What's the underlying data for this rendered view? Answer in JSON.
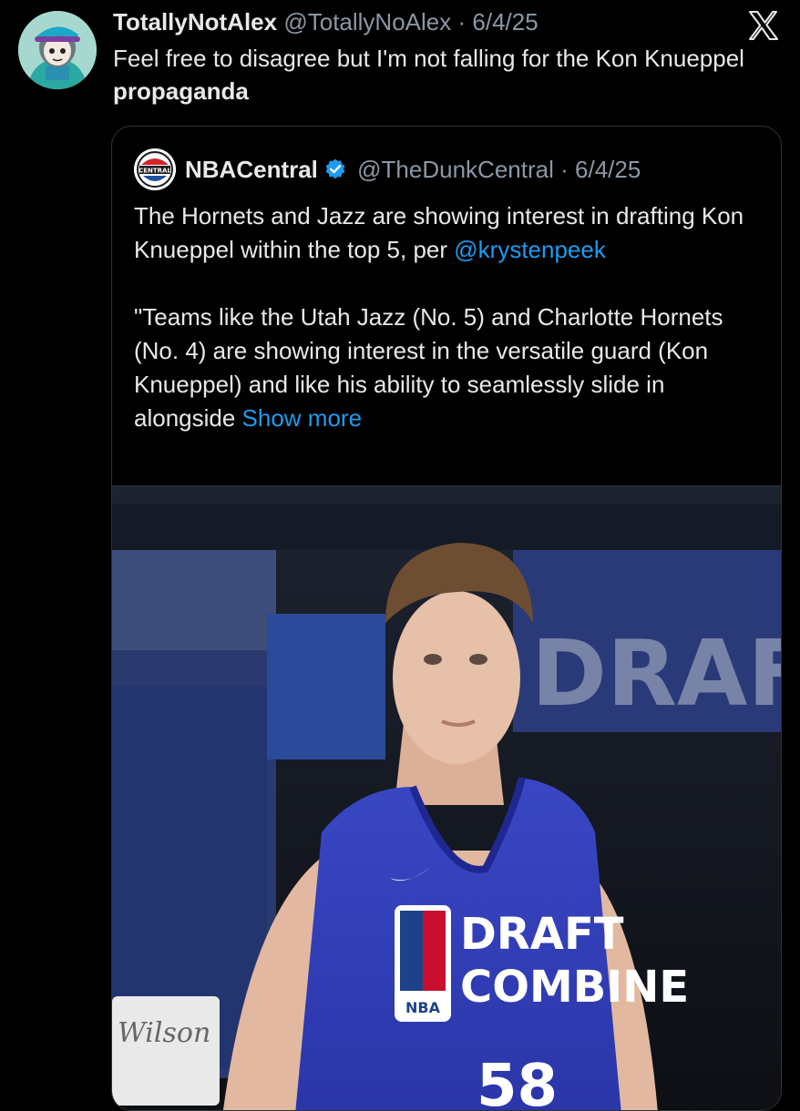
{
  "tweet": {
    "author_name": "TotallyNotAlex",
    "author_handle": "@TotallyNoAlex",
    "separator": "·",
    "date": "6/4/25",
    "text_main": "Feel free to disagree but I'm not falling for the Kon Knueppel ",
    "text_bold": "propaganda"
  },
  "quote": {
    "author_name": "NBACentral",
    "author_handle": "@TheDunkCentral",
    "separator": "·",
    "date": "6/4/25",
    "line1": "The Hornets and Jazz are showing interest in drafting Kon Knueppel within the top 5, per",
    "mention": "@krystenpeek",
    "line2": "\"Teams like the Utah Jazz (No. 5) and Charlotte Hornets (No. 4) are showing interest in the versatile guard (Kon Knueppel) and like his ability to seamlessly slide in alongside ",
    "show_more": "Show more",
    "avatar_label": "CENTRAL"
  },
  "media": {
    "banner_text": "DRAFT",
    "jersey_line1": "DRAFT",
    "jersey_line2": "COMBINE",
    "jersey_number": "58",
    "nba_badge": "NBA",
    "sign_text": "Wilson"
  },
  "colors": {
    "link": "#1d9bf0",
    "muted": "#8b98a5",
    "jersey": "#2f3bb3"
  },
  "icons": [
    "x-logo-icon",
    "verified-badge-icon"
  ]
}
